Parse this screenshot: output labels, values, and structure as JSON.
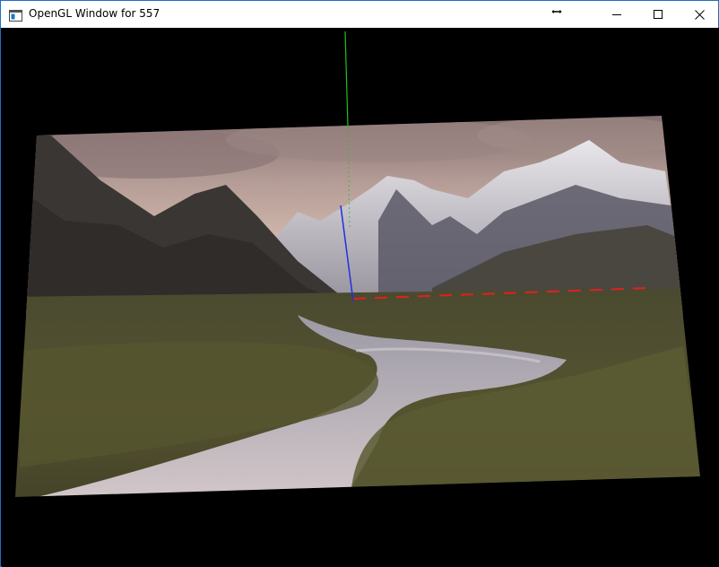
{
  "window": {
    "title": "OpenGL Window for 557"
  },
  "titlebar": {
    "app_icon": "console-app-icon",
    "cursor_icon": "horizontal-resize-cursor-icon",
    "minimize_icon": "minimize-icon",
    "maximize_icon": "maximize-icon",
    "close_icon": "close-icon"
  },
  "viewport": {
    "background_color": "#000000",
    "content": "textured-quad-landscape",
    "axis_colors": {
      "x_axis": "#e02020",
      "y_axis": "#20c020",
      "z_axis": "#2030e0"
    }
  }
}
